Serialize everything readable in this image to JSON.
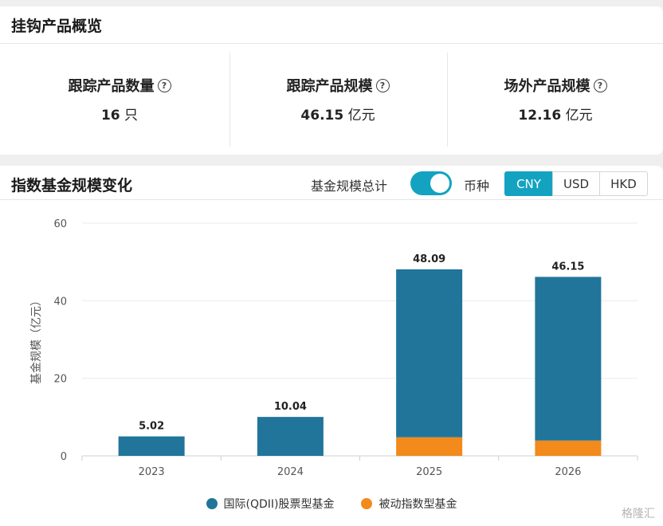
{
  "overview": {
    "title": "挂钩产品概览",
    "stats": [
      {
        "label": "跟踪产品数量",
        "value": "16",
        "unit": "只"
      },
      {
        "label": "跟踪产品规模",
        "value": "46.15",
        "unit": "亿元"
      },
      {
        "label": "场外产品规模",
        "value": "12.16",
        "unit": "亿元"
      }
    ],
    "help_glyph": "?"
  },
  "fund": {
    "title": "指数基金规模变化",
    "total_label": "基金规模总计",
    "total_toggle_on": true,
    "currency_label": "币种",
    "currencies": [
      "CNY",
      "USD",
      "HKD"
    ],
    "selected_currency": "CNY"
  },
  "chart_data": {
    "type": "bar",
    "stacked": true,
    "categories": [
      "2023",
      "2024",
      "2025",
      "2026"
    ],
    "series": [
      {
        "name": "国际(QDII)股票型基金",
        "color": "#21759b",
        "values": [
          5.02,
          10.04,
          43.3,
          42.2
        ]
      },
      {
        "name": "被动指数型基金",
        "color": "#f28a1c",
        "values": [
          0,
          0,
          4.79,
          3.95
        ]
      }
    ],
    "totals": [
      "5.02",
      "10.04",
      "48.09",
      "46.15"
    ],
    "ylabel": "基金规模（亿元）",
    "ylim": [
      0,
      60
    ],
    "yticks": [
      "0",
      "20",
      "40",
      "60"
    ],
    "grid": true,
    "legend_position": "bottom"
  },
  "watermark": "格隆汇"
}
